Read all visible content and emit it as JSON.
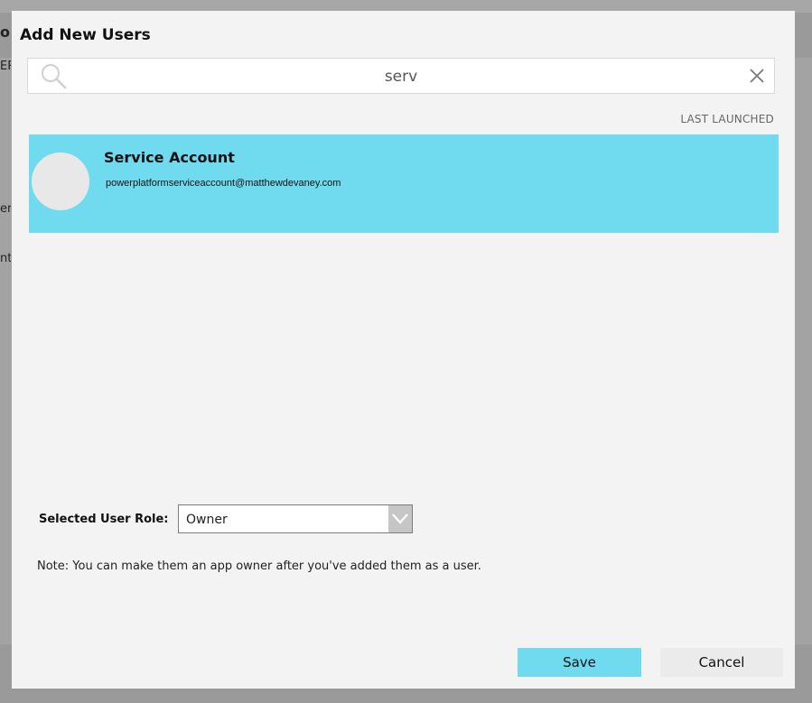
{
  "background": {
    "fragments": [
      "ol",
      "ER",
      "en",
      "nt"
    ]
  },
  "dialog": {
    "title": "Add New Users",
    "search": {
      "value": "serv",
      "icon": "search-icon",
      "clear_icon": "close-icon"
    },
    "sort_label": "LAST LAUNCHED",
    "results": [
      {
        "name": "Service Account",
        "email": "powerplatformserviceaccount@matthewdevaney.com",
        "selected": true
      }
    ],
    "role": {
      "label": "Selected User Role:",
      "value": "Owner"
    },
    "note": "Note: You can make them an app owner after you've added them as a user.",
    "buttons": {
      "save": "Save",
      "cancel": "Cancel"
    }
  },
  "colors": {
    "accent": "#70dbee",
    "dialog_bg": "#f3f3f3",
    "cancel_bg": "#ebebeb"
  }
}
